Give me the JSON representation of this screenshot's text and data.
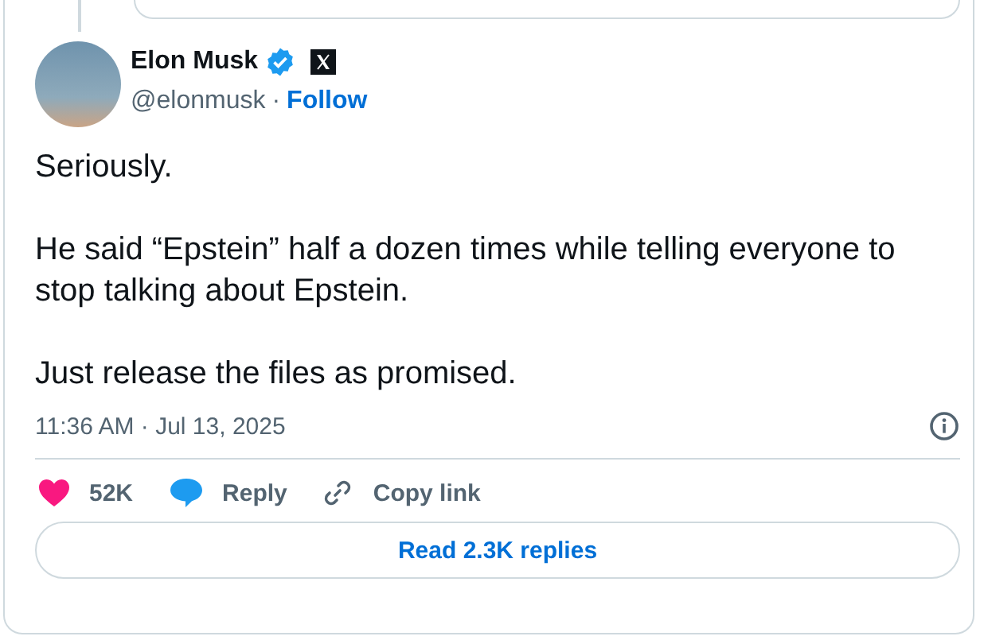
{
  "author": {
    "name": "Elon Musk",
    "verified": true,
    "handle": "@elonmusk",
    "separator": "·",
    "follow": "Follow"
  },
  "body": [
    "Seriously.",
    "He said “Epstein” half a dozen times while telling everyone to stop talking about Epstein.",
    "Just release the files as promised."
  ],
  "timestamp": "11:36 AM · Jul 13, 2025",
  "actions": [
    {
      "kind": "like",
      "label": "52K"
    },
    {
      "kind": "reply",
      "label": "Reply"
    },
    {
      "kind": "copy",
      "label": "Copy link"
    }
  ],
  "read_replies": "Read 2.3K replies"
}
